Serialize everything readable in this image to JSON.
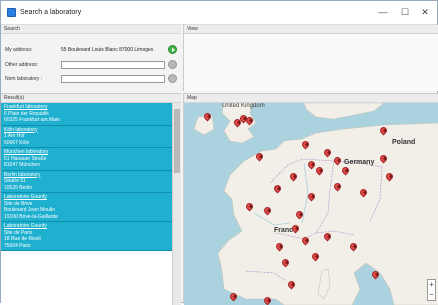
{
  "window": {
    "title": "Search a laboratory",
    "min_glyph": "—",
    "max_glyph": "☐",
    "close_glyph": "✕"
  },
  "search": {
    "header": "Search",
    "my_address_label": "My address:",
    "my_address_value": "55 Boulevard Louis Blanc 87000 Limoges",
    "other_address_label": "Other address:",
    "other_address_value": "",
    "nom_label": "Nom laboratory :",
    "nom_value": ""
  },
  "view": {
    "header": "View"
  },
  "results": {
    "header": "Result(s)",
    "items": [
      {
        "name": "Frankfurt laboratory",
        "lines": [
          "",
          "6 Platz der Republik",
          "60325 Frankfurt am Main"
        ]
      },
      {
        "name": "Köln laboratory",
        "lines": [
          "",
          "1 Am Hof",
          "50667 Köln"
        ]
      },
      {
        "name": "München laboratory",
        "lines": [
          "",
          "51 Hanauer Straße",
          "81547 München"
        ]
      },
      {
        "name": "Berlin laboratory",
        "lines": [
          "",
          "Straße 51",
          "10525 Berlin"
        ]
      },
      {
        "name": "Laboratoire Gounfy",
        "lines": [
          "Site de Brive",
          "Boulevard Jean Moulin",
          "19100 Brive-la-Gaillarde"
        ]
      },
      {
        "name": "Laboratoire Gounfy",
        "lines": [
          "Site de Paris",
          "18 Rue de Rivoli",
          "75004 Paris"
        ]
      }
    ]
  },
  "map": {
    "header": "Map",
    "labels": {
      "united_kingdom": "United Kingdom",
      "poland": "Poland",
      "germany": "Germany",
      "france": "France"
    },
    "zoom_in": "+",
    "zoom_out": "−",
    "colors": {
      "marker": "#e24a4a",
      "water": "#aad3df",
      "land": "#f2efe9",
      "result_bg": "#1fb0d0"
    }
  }
}
